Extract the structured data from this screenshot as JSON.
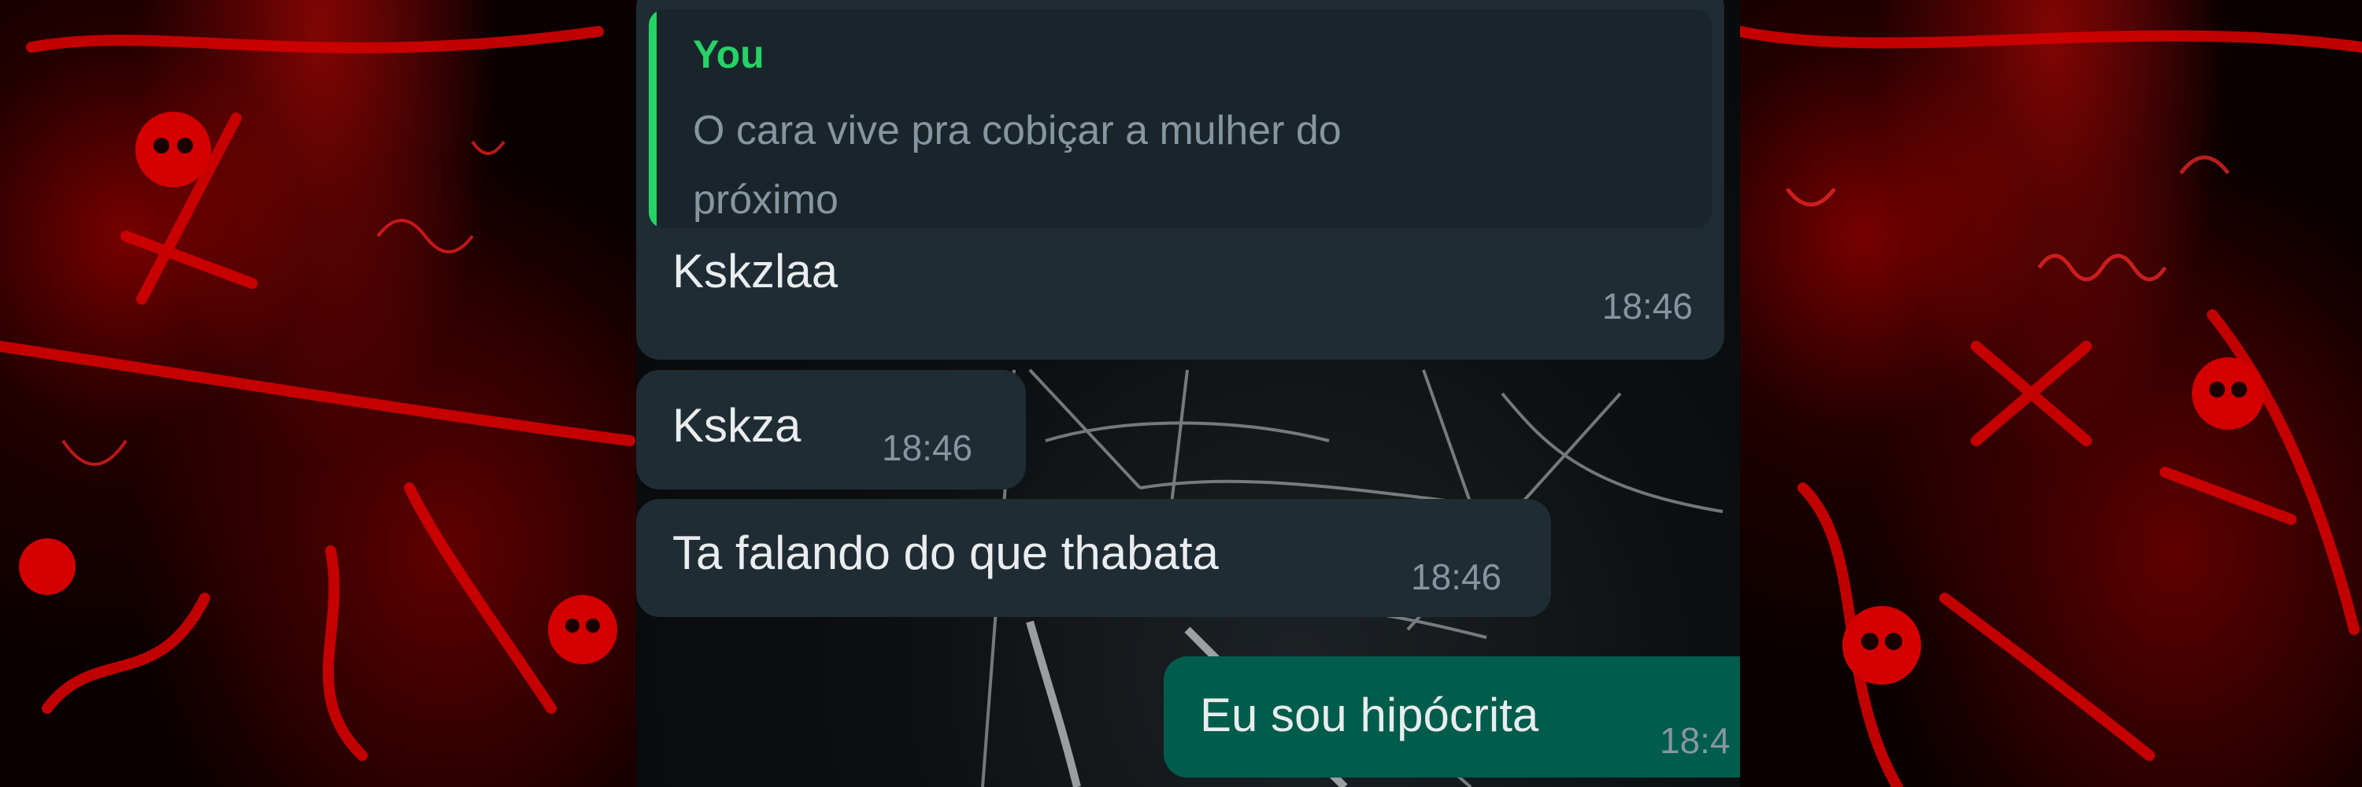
{
  "colors": {
    "incoming_bubble": "#1f2c33",
    "outgoing_bubble": "#005c4b",
    "quote_bar": "#25d366",
    "timestamp": "#8696a0",
    "side_panel_accent": "#d10000"
  },
  "messages": [
    {
      "direction": "incoming",
      "reply_to": {
        "author": "You",
        "text_line1": "O cara vive pra cobiçar a mulher do",
        "text_line2": "próximo"
      },
      "text": "Kskzlaa",
      "time": "18:46"
    },
    {
      "direction": "incoming",
      "text": "Kskza",
      "time": "18:46"
    },
    {
      "direction": "incoming",
      "text": "Ta falando do que thabata",
      "time": "18:46"
    },
    {
      "direction": "outgoing",
      "text": "Eu sou hipócrita",
      "time": "18:4"
    }
  ]
}
